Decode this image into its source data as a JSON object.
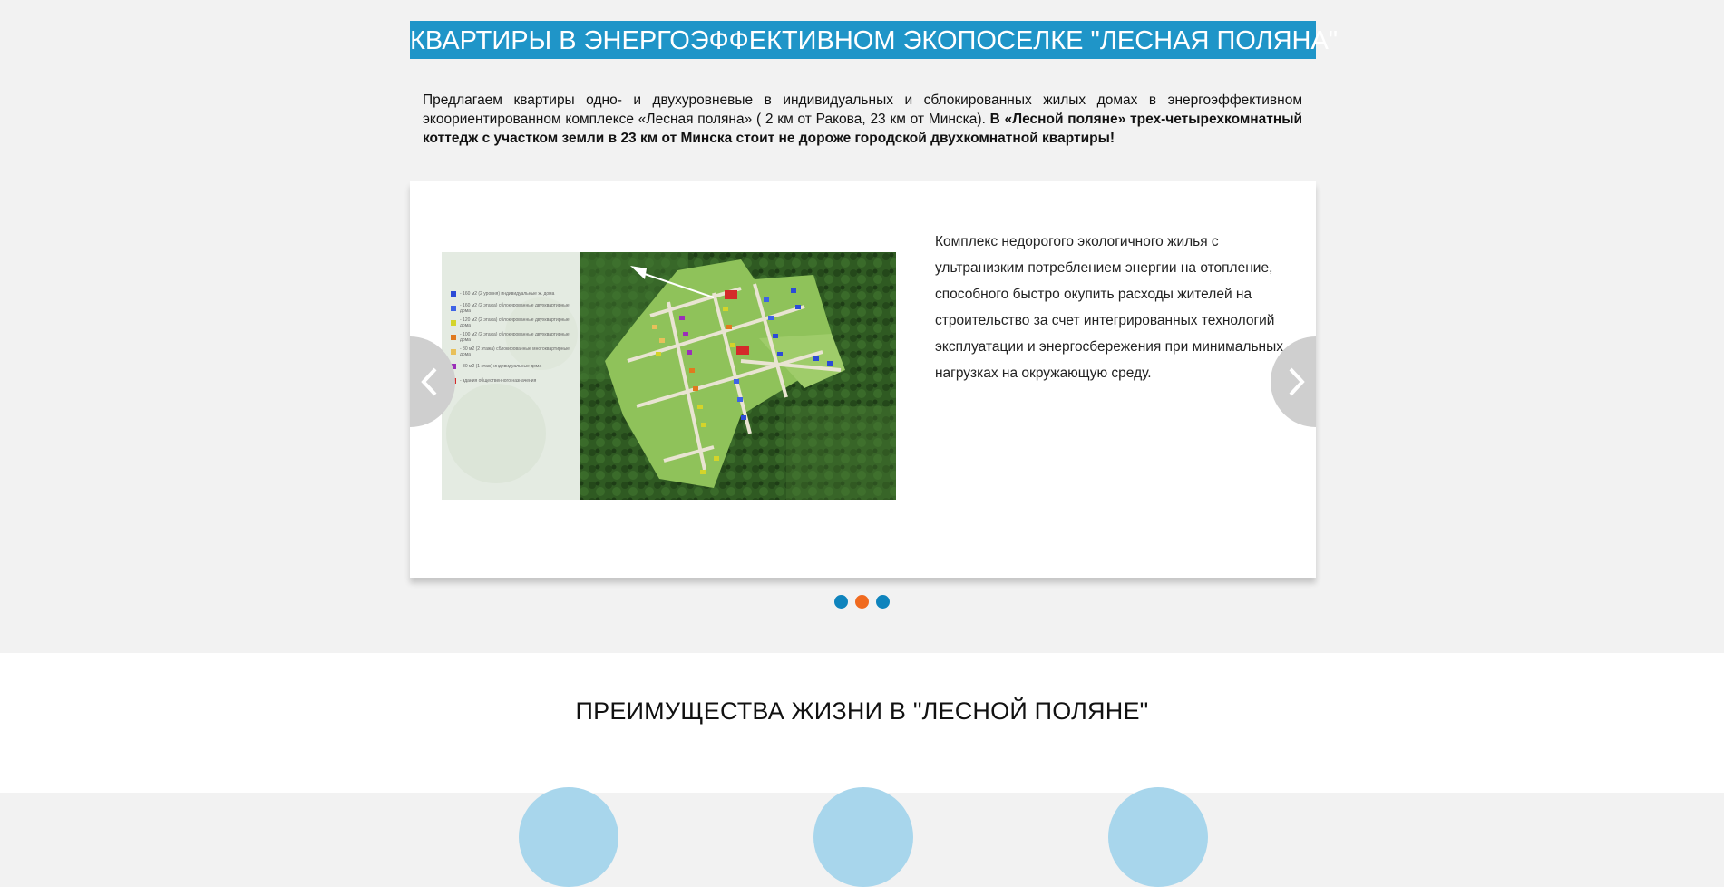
{
  "banner": {
    "title": "КВАРТИРЫ В ЭНЕРГОЭФФЕКТИВНОМ ЭКОПОСЕЛКЕ \"ЛЕСНАЯ ПОЛЯНА\""
  },
  "intro": {
    "text": "Предлагаем квартиры одно- и двухуровневые в индивидуальных и сблокированных жилых домах в энергоэффективном экоориентированном комплексе «Лесная поляна» ( 2 км от Ракова, 23 км от Минска).",
    "bold": "В «Лесной поляне» трех-четырехкомнатный коттедж с участком земли в 23 км от Минска стоит не дороже городской двухкомнатной квартиры!"
  },
  "slider": {
    "slide_text": "Комплекс недорогого экологичного жилья с ультранизким потреблением энергии на отопление, способного быстро окупить расходы жителей на строительство за счет интегрированных технологий эксплуатации и энергосбережения при минимальных нагрузках на окружающую среду.",
    "image_alt": "site-plan-map",
    "legend": [
      {
        "label": "- 160 м2 (2 уровня) индивидуальные ж. дома",
        "color": "#2c4bd6"
      },
      {
        "label": "- 160 м2 (2 этажа) сблокированные двухквартирные дома",
        "color": "#3e63e6"
      },
      {
        "label": "- 120 м2 (2 этажа) сблокированные двухквартирные дома",
        "color": "#d4d42a"
      },
      {
        "label": "- 100 м2 (2 этажа) сблокированные двухквартирные дома",
        "color": "#e07a1e"
      },
      {
        "label": "- 80 м2 (2 этажа) сблокированные многоквартирные дома",
        "color": "#e8c05a"
      },
      {
        "label": "- 80 м2 (1 этаж) индивидуальные дома",
        "color": "#9b2fb8"
      },
      {
        "label": "- здания общественного назначения",
        "color": "#d42a2a"
      }
    ],
    "dots": [
      {
        "active": false
      },
      {
        "active": true
      },
      {
        "active": false
      }
    ],
    "colors": {
      "dot": "#0f84bd",
      "dot_active": "#f06a1f"
    }
  },
  "advantages": {
    "title": "ПРЕИМУЩЕСТВА ЖИЗНИ В \"ЛЕСНОЙ ПОЛЯНЕ\""
  },
  "colors": {
    "banner": "#1f95c8",
    "background": "#f2f2f2"
  }
}
